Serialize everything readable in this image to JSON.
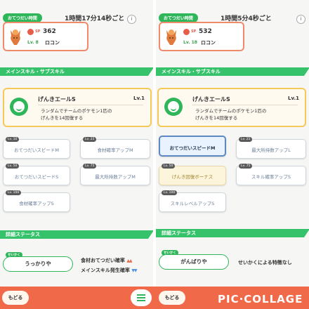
{
  "left": {
    "helper_label": "おてつだい時間",
    "help_time": "1時間17分14秒ごと",
    "info": "i",
    "pokemon": {
      "sp_label": "SP",
      "sp": "362",
      "level": "Lv. 8",
      "name": "ロコン"
    },
    "section_skill": "メインスキル・サブスキル",
    "main_skill": {
      "name": "げんきエールS",
      "level": "Lv.1",
      "desc_line1": "ランダムでチームのポケモン1匹の",
      "desc_line2": "げんきを14回復する"
    },
    "sub_skills": [
      {
        "unlock": "Lv. 10",
        "label": "おてつだいスピードM"
      },
      {
        "unlock": "Lv. 25",
        "label": "食材確率アップM"
      },
      {
        "unlock": "Lv. 50",
        "label": "おてつだいスピードS"
      },
      {
        "unlock": "Lv. 75",
        "label": "最大所持数アップM"
      },
      {
        "unlock": "Lv. 100",
        "label": "食材確率アップS"
      }
    ],
    "section_stats": "詳細ステータス",
    "nature_tag": "せいかく",
    "nature": "うっかりや",
    "stat_up": "食材おてつだい確率",
    "stat_up_arrows": "▲▲",
    "stat_down": "メインスキル発生確率",
    "stat_down_arrows": "▼▼"
  },
  "right": {
    "helper_label": "おてつだい時間",
    "help_time": "1時間5分4秒ごと",
    "info": "i",
    "pokemon": {
      "sp_label": "SP",
      "sp": "532",
      "level": "Lv. 18",
      "name": "ロコン"
    },
    "section_skill": "メインスキル・サブスキル",
    "main_skill": {
      "name": "げんきエールS",
      "level": "Lv.1",
      "desc_line1": "ランダムでチームのポケモン1匹の",
      "desc_line2": "げんきを14回復する"
    },
    "sub_skills": [
      {
        "unlock": "Lv. 10",
        "label": "おてつだいスピードM"
      },
      {
        "unlock": "Lv. 25",
        "label": "最大所持数アップL"
      },
      {
        "unlock": "Lv. 50",
        "label": "げんき回復ボーナス"
      },
      {
        "unlock": "Lv. 75",
        "label": "スキル確率アップS"
      },
      {
        "unlock": "Lv. 100",
        "label": "スキルレベルアップS"
      }
    ],
    "section_stats": "詳細ステータス",
    "nature_tag": "せいかく",
    "nature": "がんばりや",
    "nature_effect": "せいかくによる特徴なし"
  },
  "bottom": {
    "back_left": "もどる",
    "back_right": "もどる",
    "brand": "PIC·COLLAGE"
  },
  "colors": {
    "green": "#2fb65a",
    "accent": "#f06a4a",
    "gold": "#f5c85a"
  }
}
